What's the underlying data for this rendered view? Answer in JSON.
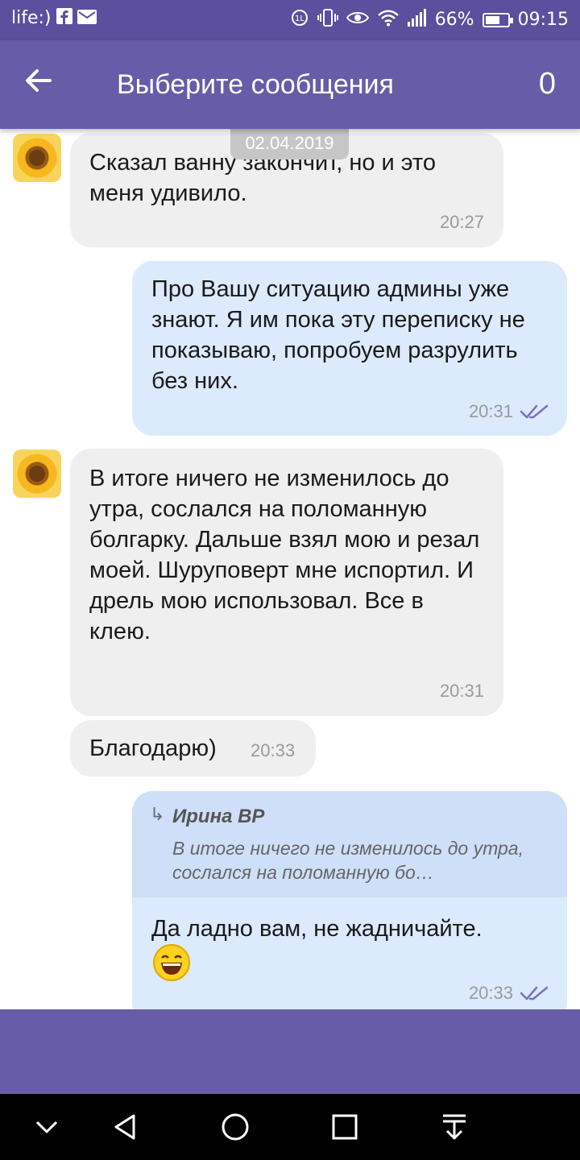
{
  "status_bar": {
    "carrier": "life:)",
    "battery": "66%",
    "battery_level": 0.66,
    "time": "09:15"
  },
  "header": {
    "title": "Выберите сообщения",
    "count": "0"
  },
  "chat": {
    "date_label": "02.04.2019",
    "messages": [
      {
        "direction": "in",
        "text": "Сказал ванну закончит, но и это меня удивило.",
        "time": "20:27"
      },
      {
        "direction": "out",
        "text": "Про Вашу ситуацию админы уже знают. Я им пока эту переписку не показываю, попробуем разрулить без них.",
        "time": "20:31"
      },
      {
        "direction": "in",
        "text": "В итоге ничего не изменилось до утра, сослался на поломанную болгарку. Дальше взял мою и резал моей. Шуруповерт мне испортил. И дрель мою использовал. Все в клею.",
        "time": "20:31"
      },
      {
        "direction": "in",
        "text": "Благодарю)",
        "time": "20:33"
      },
      {
        "direction": "out",
        "reply_author": "Ирина ВР",
        "reply_text": "В итоге ничего не изменилось до утра, сослался на поломанную бо…",
        "text": "Да ладно вам, не жадничайте.",
        "time": "20:33"
      }
    ]
  },
  "colors": {
    "header": "#665ca8",
    "status_bar": "#5b4f9e",
    "incoming_bubble": "#efefef",
    "outgoing_bubble": "#dbeafc",
    "ticks": "#7a6fc4"
  },
  "icons": [
    "back-arrow-icon",
    "double-check-icon",
    "reply-arrow-icon",
    "laughing-emoji-icon",
    "nav-hide-icon",
    "nav-back-icon",
    "nav-home-icon",
    "nav-recents-icon",
    "nav-notifications-icon"
  ]
}
